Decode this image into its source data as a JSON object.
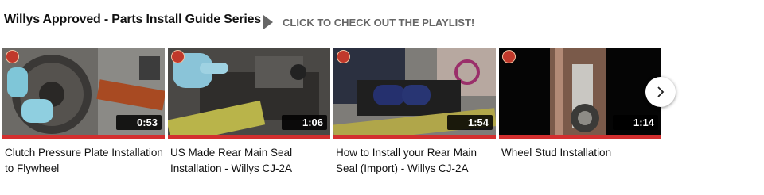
{
  "header": {
    "series_title": "Willys Approved - Parts Install Guide Series",
    "playlist_link": "CLICK TO CHECK OUT THE PLAYLIST!"
  },
  "videos": [
    {
      "title": "Clutch Pressure Plate Installation to Flywheel",
      "duration": "0:53"
    },
    {
      "title": "US Made Rear Main Seal Installation - Willys CJ-2A",
      "duration": "1:06"
    },
    {
      "title": "How to Install your Rear Main Seal (Import) - Willys CJ-2A",
      "duration": "1:54"
    },
    {
      "title": "Wheel Stud Installation",
      "duration": "1:14"
    }
  ],
  "colors": {
    "progress": "#d32f2f",
    "header_text": "#111111",
    "link_text": "#666666"
  },
  "icons": {
    "play": "play-triangle-icon",
    "next": "chevron-right-icon"
  }
}
